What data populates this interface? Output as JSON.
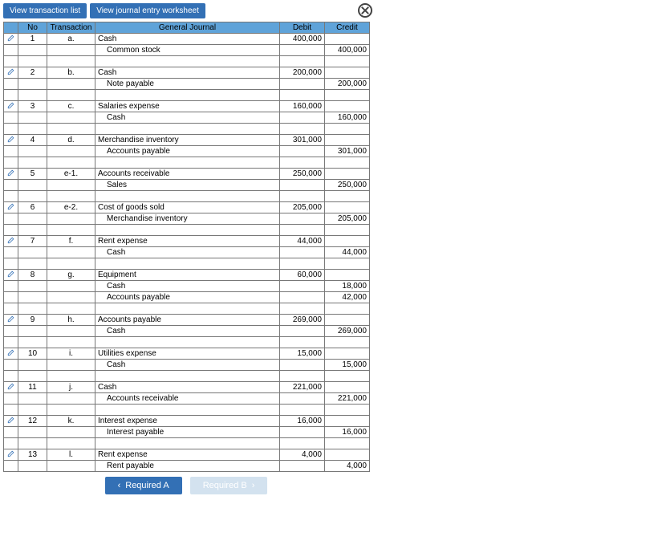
{
  "topbar": {
    "view_transaction_list": "View transaction list",
    "view_journal_entry_worksheet": "View journal entry worksheet"
  },
  "headers": {
    "no": "No",
    "transaction": "Transaction",
    "general_journal": "General Journal",
    "debit": "Debit",
    "credit": "Credit"
  },
  "entries": [
    {
      "no": "1",
      "tx": "a.",
      "lines": [
        {
          "gj": "Cash",
          "debit": "400,000",
          "credit": ""
        },
        {
          "gj": "Common stock",
          "indent": true,
          "debit": "",
          "credit": "400,000"
        },
        {
          "gj": "",
          "debit": "",
          "credit": ""
        }
      ]
    },
    {
      "no": "2",
      "tx": "b.",
      "lines": [
        {
          "gj": "Cash",
          "debit": "200,000",
          "credit": ""
        },
        {
          "gj": "Note payable",
          "indent": true,
          "debit": "",
          "credit": "200,000"
        },
        {
          "gj": "",
          "debit": "",
          "credit": ""
        }
      ]
    },
    {
      "no": "3",
      "tx": "c.",
      "lines": [
        {
          "gj": "Salaries expense",
          "debit": "160,000",
          "credit": ""
        },
        {
          "gj": "Cash",
          "indent": true,
          "debit": "",
          "credit": "160,000"
        },
        {
          "gj": "",
          "debit": "",
          "credit": ""
        }
      ]
    },
    {
      "no": "4",
      "tx": "d.",
      "lines": [
        {
          "gj": "Merchandise inventory",
          "debit": "301,000",
          "credit": ""
        },
        {
          "gj": "Accounts payable",
          "indent": true,
          "debit": "",
          "credit": "301,000"
        },
        {
          "gj": "",
          "debit": "",
          "credit": ""
        }
      ]
    },
    {
      "no": "5",
      "tx": "e-1.",
      "lines": [
        {
          "gj": "Accounts receivable",
          "debit": "250,000",
          "credit": ""
        },
        {
          "gj": "Sales",
          "indent": true,
          "debit": "",
          "credit": "250,000"
        },
        {
          "gj": "",
          "debit": "",
          "credit": ""
        }
      ]
    },
    {
      "no": "6",
      "tx": "e-2.",
      "lines": [
        {
          "gj": "Cost of goods sold",
          "debit": "205,000",
          "credit": ""
        },
        {
          "gj": "Merchandise inventory",
          "indent": true,
          "debit": "",
          "credit": "205,000"
        },
        {
          "gj": "",
          "debit": "",
          "credit": ""
        }
      ]
    },
    {
      "no": "7",
      "tx": "f.",
      "lines": [
        {
          "gj": "Rent expense",
          "debit": "44,000",
          "credit": ""
        },
        {
          "gj": "Cash",
          "indent": true,
          "debit": "",
          "credit": "44,000"
        },
        {
          "gj": "",
          "debit": "",
          "credit": ""
        }
      ]
    },
    {
      "no": "8",
      "tx": "g.",
      "lines": [
        {
          "gj": "Equipment",
          "debit": "60,000",
          "credit": ""
        },
        {
          "gj": "Cash",
          "indent": true,
          "debit": "",
          "credit": "18,000"
        },
        {
          "gj": "Accounts payable",
          "indent": true,
          "debit": "",
          "credit": "42,000"
        },
        {
          "gj": "",
          "debit": "",
          "credit": ""
        }
      ]
    },
    {
      "no": "9",
      "tx": "h.",
      "lines": [
        {
          "gj": "Accounts payable",
          "debit": "269,000",
          "credit": ""
        },
        {
          "gj": "Cash",
          "indent": true,
          "debit": "",
          "credit": "269,000"
        },
        {
          "gj": "",
          "debit": "",
          "credit": ""
        }
      ]
    },
    {
      "no": "10",
      "tx": "i.",
      "lines": [
        {
          "gj": "Utilities expense",
          "debit": "15,000",
          "credit": ""
        },
        {
          "gj": "Cash",
          "indent": true,
          "debit": "",
          "credit": "15,000"
        },
        {
          "gj": "",
          "debit": "",
          "credit": ""
        }
      ]
    },
    {
      "no": "11",
      "tx": "j.",
      "lines": [
        {
          "gj": "Cash",
          "debit": "221,000",
          "credit": ""
        },
        {
          "gj": "Accounts receivable",
          "indent": true,
          "debit": "",
          "credit": "221,000"
        },
        {
          "gj": "",
          "debit": "",
          "credit": ""
        }
      ]
    },
    {
      "no": "12",
      "tx": "k.",
      "lines": [
        {
          "gj": "Interest expense",
          "debit": "16,000",
          "credit": ""
        },
        {
          "gj": "Interest payable",
          "indent": true,
          "debit": "",
          "credit": "16,000"
        },
        {
          "gj": "",
          "debit": "",
          "credit": ""
        }
      ]
    },
    {
      "no": "13",
      "tx": "l.",
      "lines": [
        {
          "gj": "Rent expense",
          "debit": "4,000",
          "credit": ""
        },
        {
          "gj": "Rent payable",
          "indent": true,
          "debit": "",
          "credit": "4,000"
        }
      ]
    }
  ],
  "nav": {
    "prev": "Required A",
    "next": "Required B"
  }
}
